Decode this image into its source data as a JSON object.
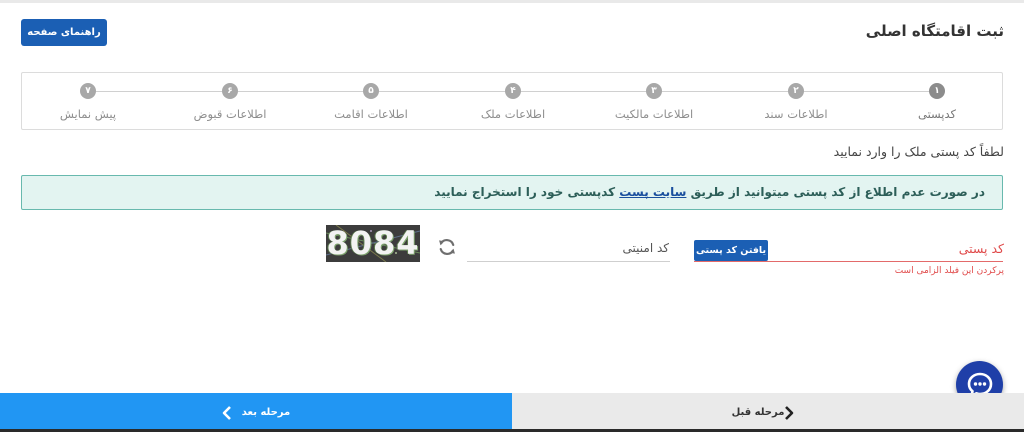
{
  "header": {
    "title": "ثبت اقامتگاه اصلی",
    "guide_button": "راهنمای صفحه"
  },
  "stepper": {
    "steps": [
      {
        "number": "۱",
        "label": "کدپستی"
      },
      {
        "number": "۲",
        "label": "اطلاعات سند"
      },
      {
        "number": "۳",
        "label": "اطلاعات مالکیت"
      },
      {
        "number": "۴",
        "label": "اطلاعات ملک"
      },
      {
        "number": "۵",
        "label": "اطلاعات اقامت"
      },
      {
        "number": "۶",
        "label": "اطلاعات قبوض"
      },
      {
        "number": "۷",
        "label": "پیش نمایش"
      }
    ]
  },
  "instruction": "لطفاً کد پستی ملک را وارد نمایید",
  "alert": {
    "before": "در صورت عدم اطلاع از کد پستی میتوانید از طریق ",
    "link": "سایت پست",
    "after": " کدپستی خود را استخراج نمایید"
  },
  "form": {
    "postal_label": "کد پستی",
    "find_button": "یافتن کد پستی",
    "required_message": "پرکردن این فیلد الزامی است",
    "security_label": "کد امنیتی",
    "captcha_text": "8084"
  },
  "footer": {
    "prev_label": "مرحله قبل",
    "next_label": "مرحله بعد"
  },
  "colors": {
    "primary": "#1b5fb4",
    "footer_next": "#2196f3",
    "alert_bg": "#e3f4f1",
    "alert_border": "#68b9ae",
    "error": "#e04a4a"
  }
}
